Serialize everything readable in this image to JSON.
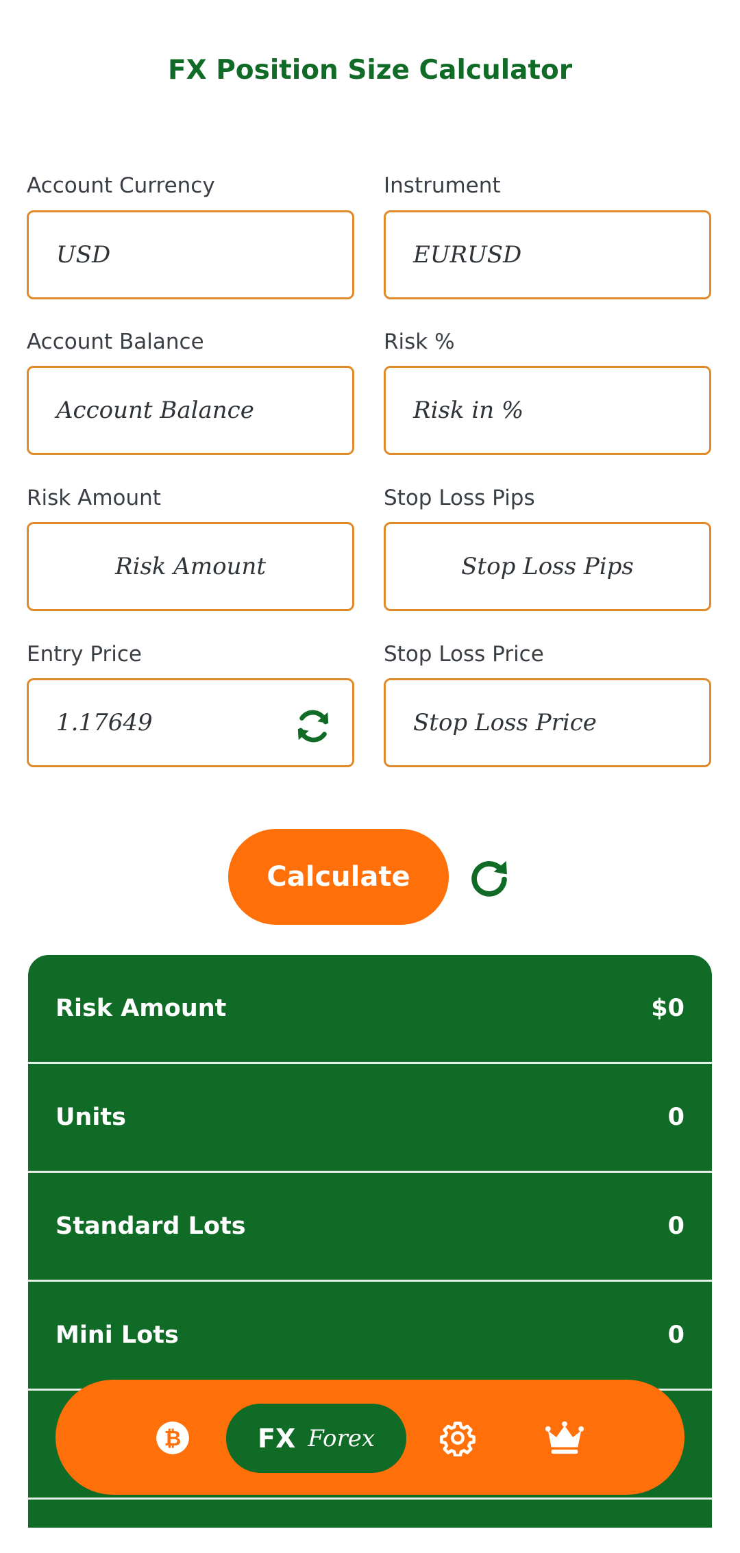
{
  "header": {
    "title": "FX Position Size Calculator"
  },
  "form": {
    "account_currency": {
      "label": "Account Currency",
      "value": "USD"
    },
    "instrument": {
      "label": "Instrument",
      "value": "EURUSD"
    },
    "account_balance": {
      "label": "Account Balance",
      "placeholder": "Account Balance"
    },
    "risk_percent": {
      "label": "Risk %",
      "placeholder": "Risk in %"
    },
    "risk_amount": {
      "label": "Risk Amount",
      "placeholder": "Risk Amount"
    },
    "stop_loss_pips": {
      "label": "Stop Loss Pips",
      "placeholder": "Stop Loss Pips"
    },
    "entry_price": {
      "label": "Entry Price",
      "value": "1.17649",
      "icon": "refresh-icon"
    },
    "stop_loss_price": {
      "label": "Stop Loss Price",
      "placeholder": "Stop Loss Price"
    }
  },
  "actions": {
    "calculate_label": "Calculate",
    "reset_icon": "reset-icon"
  },
  "results": [
    {
      "label": "Risk Amount",
      "value": "$0"
    },
    {
      "label": "Units",
      "value": "0"
    },
    {
      "label": "Standard Lots",
      "value": "0"
    },
    {
      "label": "Mini Lots",
      "value": "0"
    }
  ],
  "bottom_nav": {
    "items": [
      {
        "icon": "bitcoin-icon"
      },
      {
        "icon_text": "FX",
        "label": "Forex",
        "active": true
      },
      {
        "icon": "settings-gear-icon"
      },
      {
        "icon": "crown-icon"
      }
    ]
  },
  "colors": {
    "brand_green": "#0f6b26",
    "accent_orange": "#ff6f0a",
    "border_orange": "#e08a2a"
  }
}
